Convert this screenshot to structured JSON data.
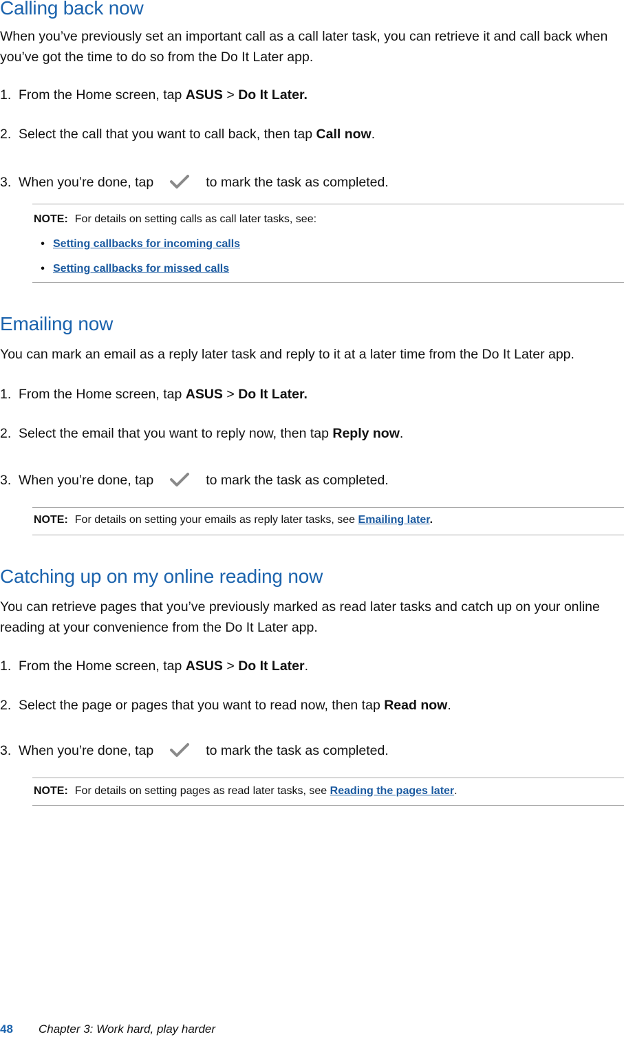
{
  "sections": [
    {
      "title": "Calling back now",
      "intro": "When you’ve previously set an important call as a call later task, you can retrieve it and call back when you’ve got the time to do so from the Do It Later app.",
      "steps": [
        {
          "num": "1.",
          "pre": "From the Home screen, tap ",
          "b1": "ASUS",
          "mid": " > ",
          "b2": "Do It Later.",
          "post": ""
        },
        {
          "num": "2.",
          "pre": "Select the call that you want to call back, then tap ",
          "b1": "Call now",
          "post": "."
        },
        {
          "num": "3.",
          "pre": "When you’re done, tap",
          "icon": "check-icon",
          "post": "to mark the task as completed."
        }
      ],
      "note": {
        "label": "NOTE:",
        "text": "For details on setting calls as call later tasks, see:",
        "bullets": [
          "Setting callbacks for incoming calls",
          "Setting callbacks for missed calls"
        ]
      }
    },
    {
      "title": "Emailing now",
      "intro": "You can mark an email as a reply later task and reply to it at a later time from the Do It Later app.",
      "steps": [
        {
          "num": "1.",
          "pre": "From the Home screen, tap ",
          "b1": "ASUS",
          "mid": " > ",
          "b2": "Do It Later.",
          "post": ""
        },
        {
          "num": "2.",
          "pre": "Select the email that you want to reply now, then tap ",
          "b1": "Reply now",
          "post": "."
        },
        {
          "num": "3.",
          "pre": "When you’re done, tap",
          "icon": "check-icon",
          "post": "to mark the task as completed."
        }
      ],
      "note": {
        "label": "NOTE:",
        "text": "For details on setting your emails as reply later tasks, see ",
        "link": "Emailing later",
        "post": "."
      }
    },
    {
      "title": "Catching up on my online reading now",
      "intro": "You can retrieve pages that you’ve previously marked as read later tasks and catch up on your online reading at your convenience from the Do It Later app.",
      "steps": [
        {
          "num": "1.",
          "pre": "From the Home screen, tap ",
          "b1": "ASUS",
          "mid": " > ",
          "b2": "Do It Later",
          "post": "."
        },
        {
          "num": "2.",
          "pre": "Select the page or pages that you want to read now, then tap ",
          "b1": "Read now",
          "post": "."
        },
        {
          "num": "3.",
          "pre": "When you’re done, tap",
          "icon": "check-icon",
          "post": "to mark the task as completed."
        }
      ],
      "note": {
        "label": "NOTE:",
        "text": "For details on setting pages as read later tasks, see ",
        "link": "Reading the pages later",
        "post": "."
      }
    }
  ],
  "footer": {
    "page_number": "48",
    "chapter": "Chapter 3:  Work hard, play harder"
  },
  "colors": {
    "heading": "#1b63ad",
    "link": "#1b5aa0",
    "check_icon": "#8a8a8a",
    "rule": "#a8a8a8"
  }
}
